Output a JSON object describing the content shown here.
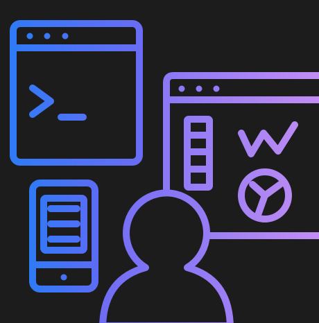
{
  "background_color": "#1c1c1c",
  "accent_colors": {
    "blue": "#2f7af6",
    "indigo": "#5c6cf5",
    "violet": "#9a7cf4",
    "lavender": "#c28df4"
  },
  "icons": [
    "terminal-window-icon",
    "terminal-prompt-icon",
    "browser-window-icon",
    "line-chart-icon",
    "pie-chart-icon",
    "sidebar-panel-icon",
    "smartphone-icon",
    "user-person-icon"
  ]
}
